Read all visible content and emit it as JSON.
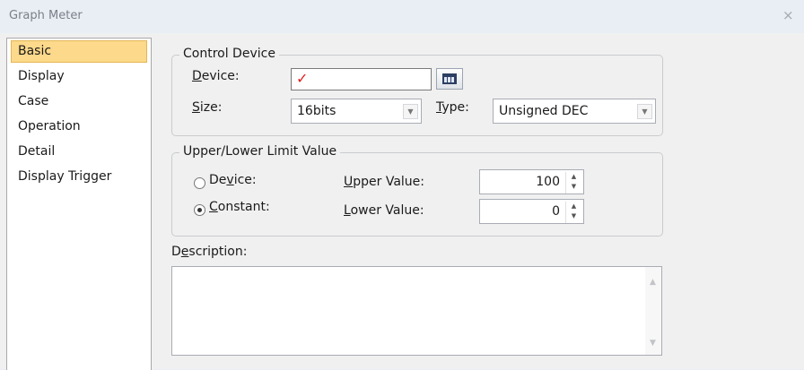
{
  "window": {
    "title": "Graph Meter",
    "close_glyph": "×"
  },
  "sidebar": {
    "items": [
      {
        "label": "Basic",
        "selected": true
      },
      {
        "label": "Display"
      },
      {
        "label": "Case"
      },
      {
        "label": "Operation"
      },
      {
        "label": "Detail"
      },
      {
        "label": "Display Trigger"
      }
    ]
  },
  "control_device": {
    "legend": "Control Device",
    "device": {
      "pre": "",
      "key": "D",
      "post": "evice:",
      "value": "✓"
    },
    "size": {
      "pre": "",
      "key": "S",
      "post": "ize:",
      "value": "16bits"
    },
    "type": {
      "pre": "",
      "key": "T",
      "post": "ype:",
      "value": "Unsigned DEC"
    }
  },
  "limit": {
    "legend": "Upper/Lower Limit Value",
    "device_radio": {
      "pre": "De",
      "key": "v",
      "post": "ice:",
      "checked": false
    },
    "constant_radio": {
      "pre": "",
      "key": "C",
      "post": "onstant:",
      "checked": true
    },
    "upper": {
      "pre": "",
      "key": "U",
      "post": "pper Value:",
      "value": "100"
    },
    "lower": {
      "pre": "",
      "key": "L",
      "post": "ower Value:",
      "value": "0"
    }
  },
  "description": {
    "pre": "D",
    "key": "e",
    "post": "scription:",
    "value": ""
  },
  "icons": {
    "combo_arrow": "▼",
    "spin_up": "▲",
    "spin_down": "▼",
    "scroll_up": "▲",
    "scroll_down": "▼"
  },
  "colors": {
    "selected_bg": "#fcd98b",
    "check_red": "#e02020"
  }
}
